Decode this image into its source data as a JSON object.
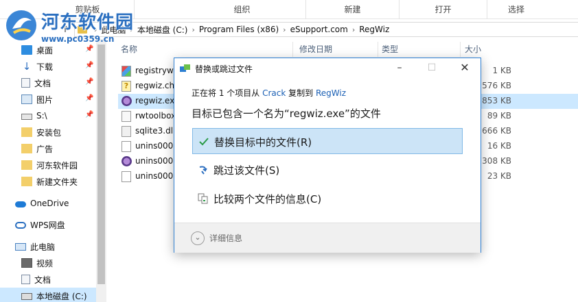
{
  "ribbon": {
    "groups": [
      "剪贴板",
      "组织",
      "新建",
      "打开",
      "选择"
    ]
  },
  "watermark": {
    "title": "河东软件园",
    "url": "www.pc0359.cn"
  },
  "address": {
    "crumbs": [
      "此电脑",
      "本地磁盘 (C:)",
      "Program Files (x86)",
      "eSupport.com",
      "RegWiz"
    ]
  },
  "nav": {
    "items": [
      {
        "label": "桌面",
        "icon": "desktop-icon",
        "pinned": true
      },
      {
        "label": "下载",
        "icon": "download-icon",
        "pinned": true
      },
      {
        "label": "文档",
        "icon": "documents-icon",
        "pinned": true
      },
      {
        "label": "图片",
        "icon": "pictures-icon",
        "pinned": true
      },
      {
        "label": "S:\\",
        "icon": "drive-icon",
        "pinned": true
      },
      {
        "label": "安装包",
        "icon": "folder-icon",
        "pinned": false
      },
      {
        "label": "广告",
        "icon": "folder-icon",
        "pinned": false
      },
      {
        "label": "河东软件园",
        "icon": "folder-icon",
        "pinned": false
      },
      {
        "label": "新建文件夹",
        "icon": "folder-icon",
        "pinned": false
      },
      {
        "label": "OneDrive",
        "icon": "onedrive-icon",
        "pinned": false
      },
      {
        "label": "WPS网盘",
        "icon": "wps-cloud-icon",
        "pinned": false
      },
      {
        "label": "此电脑",
        "icon": "this-pc-icon",
        "pinned": false
      },
      {
        "label": "视频",
        "icon": "videos-icon",
        "pinned": false
      },
      {
        "label": "文档",
        "icon": "documents-icon",
        "pinned": false
      },
      {
        "label": "本地磁盘 (C:)",
        "icon": "local-disk-icon",
        "pinned": false
      }
    ]
  },
  "files": {
    "headers": {
      "name": "名称",
      "modified": "修改日期",
      "type": "类型",
      "size": "大小"
    },
    "rows": [
      {
        "name": "registrywi",
        "size": "1 KB",
        "icon": "registry-file-icon"
      },
      {
        "name": "regwiz.chi",
        "size": "576 KB",
        "icon": "help-file-icon"
      },
      {
        "name": "regwiz.exe",
        "size": "853 KB",
        "icon": "exe-file-icon",
        "selected": true
      },
      {
        "name": "rwtoolbox",
        "size": "89 KB",
        "icon": "generic-file-icon"
      },
      {
        "name": "sqlite3.dll",
        "size": "666 KB",
        "icon": "dll-file-icon"
      },
      {
        "name": "unins000.",
        "size": "16 KB",
        "icon": "generic-file-icon"
      },
      {
        "name": "unins000.",
        "size": "308 KB",
        "icon": "exe-file-icon"
      },
      {
        "name": "unins000.",
        "size": "23 KB",
        "icon": "generic-file-icon"
      }
    ]
  },
  "dialog": {
    "title": "替换或跳过文件",
    "sub_prefix": "正在将 1 个项目从",
    "source": "Crack",
    "sub_mid": "复制到",
    "dest": "RegWiz",
    "headline": "目标已包含一个名为“regwiz.exe”的文件",
    "options": [
      {
        "label": "替换目标中的文件(R)",
        "icon": "checkmark-icon",
        "selected": true
      },
      {
        "label": "跳过该文件(S)",
        "icon": "skip-arrow-icon",
        "selected": false
      },
      {
        "label": "比较两个文件的信息(C)",
        "icon": "compare-files-icon",
        "selected": false
      }
    ],
    "more_label": "详细信息"
  },
  "colors": {
    "accent": "#2d7fd2",
    "selection": "#cce8ff",
    "link": "#1a5fb4",
    "watermark": "#2a6fc0"
  }
}
